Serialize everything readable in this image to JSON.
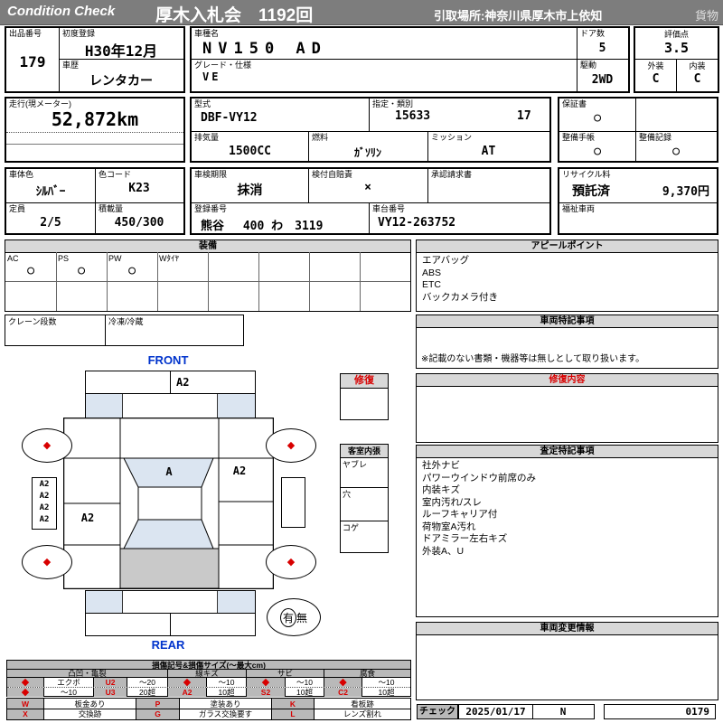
{
  "header": {
    "brand": "Condition  Check",
    "title": "厚木入札会　1192回",
    "pickup": "引取場所:神奈川県厚木市上依知",
    "cargo": "貨物"
  },
  "info": {
    "lot_label": "出品番号",
    "lot": "179",
    "first_reg_label": "初度登録",
    "first_reg": "H30年12月",
    "history_label": "車歴",
    "history": "レンタカー",
    "model_label": "車種名",
    "model": "NV150 AD",
    "grade_label": "グレード・仕様",
    "grade": "VE",
    "doors_label": "ドア数",
    "doors": "5",
    "drive_label": "駆動",
    "drive": "2WD",
    "score_label": "評価点",
    "score": "3.5",
    "ext_label": "外装",
    "ext": "C",
    "int_label": "内装",
    "int": "C",
    "odo_label": "走行(現メーター)",
    "odo": "52,872km",
    "type_label": "型式",
    "type": "DBF-VY12",
    "class_label": "指定・類別",
    "class1": "15633",
    "class2": "17",
    "disp_label": "排気量",
    "disp": "1500CC",
    "fuel_label": "燃料",
    "fuel": "ｶﾞｿﾘﾝ",
    "trans_label": "ミッション",
    "trans": "AT",
    "warranty_label": "保証書",
    "warranty": "○",
    "maint_book_label": "整備手帳",
    "maint_book": "○",
    "maint_rec_label": "整備記録",
    "maint_rec": "○",
    "color_label": "車体色",
    "color": "ｼﾙﾊﾞｰ",
    "color_code_label": "色コード",
    "color_code": "K23",
    "inspection_label": "車検期限",
    "inspection": "抹消",
    "insurance_label": "検付自賠責",
    "insurance": "×",
    "approval_label": "承認請求書",
    "recycle_label": "リサイクル料",
    "recycle_status": "預託済",
    "recycle_fee": "9,370円",
    "capacity_label": "定員",
    "capacity": "2/5",
    "load_label": "積載量",
    "load": "450/300",
    "reg_no_label": "登録番号",
    "reg_no": "熊谷　 400 わ　3119",
    "chassis_label": "車台番号",
    "chassis": "VY12-263752",
    "welfare_label": "福祉車両"
  },
  "equipment": {
    "title": "装備",
    "items": [
      {
        "label": "AC",
        "mark": "○"
      },
      {
        "label": "PS",
        "mark": "○"
      },
      {
        "label": "PW",
        "mark": "○"
      },
      {
        "label": "Wﾀｲﾔ",
        "mark": ""
      }
    ],
    "crane_label": "クレーン段数",
    "fridge_label": "冷凍/冷蔵"
  },
  "diagram": {
    "front": "FRONT",
    "rear": "REAR",
    "front_bumper_mark": "A2",
    "windshield_mark": "A",
    "right_door_mark": "A2",
    "left_rear_door_mark": "A2",
    "left_strip": [
      "A2",
      "A2",
      "A2",
      "A2"
    ],
    "wheel_mark": "◆",
    "spare_yes": "有",
    "spare_no": "無",
    "repair_title": "修復",
    "cabin_title": "客室内張",
    "cabin_items": [
      "ヤブレ",
      "穴",
      "コゲ"
    ]
  },
  "sections": {
    "appeal_title": "アピールポイント",
    "appeal_items": [
      "エアバッグ",
      "ABS",
      "ETC",
      "バックカメラ付き"
    ],
    "notes_title": "車両特記事項",
    "notes_footer": "※記載のない書類・機器等は無しとして取り扱います。",
    "repair_title": "修復内容",
    "assessment_title": "査定特記事項",
    "assessment_items": [
      "社外ナビ",
      "パワーウインドウ前席のみ",
      "内装キズ",
      "室内汚れ/スレ",
      "ルーフキャリア付",
      "荷物室A汚れ",
      "ドアミラー左右キズ",
      "外装A、U"
    ],
    "change_title": "車両変更情報",
    "check_label": "チェック",
    "check_date": "2025/01/17",
    "check_code": "N",
    "check_no": "0179"
  },
  "legend": {
    "title": "損傷記号&損傷サイズ(～最大cm)",
    "groups": [
      "凸凹・亀裂",
      "線キズ",
      "サビ",
      "腐食"
    ],
    "rows": [
      [
        "◆",
        "エクボ",
        "U2",
        "～20",
        "◆",
        "～10",
        "◆",
        "～10",
        "◆",
        "～10"
      ],
      [
        "◆",
        "～10",
        "U3",
        "20超",
        "A2",
        "10超",
        "S2",
        "10超",
        "C2",
        "10超"
      ]
    ],
    "codes": [
      [
        "W",
        "板金あり",
        "P",
        "塗装あり",
        "K",
        "看板跡"
      ],
      [
        "X",
        "交換跡",
        "G",
        "ガラス交換要す",
        "L",
        "レンズ割れ"
      ]
    ]
  },
  "colors": {
    "header_bar": "#7d7d7d",
    "section_header_bg": "#d8d8d8",
    "legend_code_bg": "#b9b9b9",
    "glass_blue": "#dbe5f1",
    "cargo_gray": "#c9c9c9",
    "accent_red": "#d80000",
    "accent_blue": "#0033cc"
  }
}
